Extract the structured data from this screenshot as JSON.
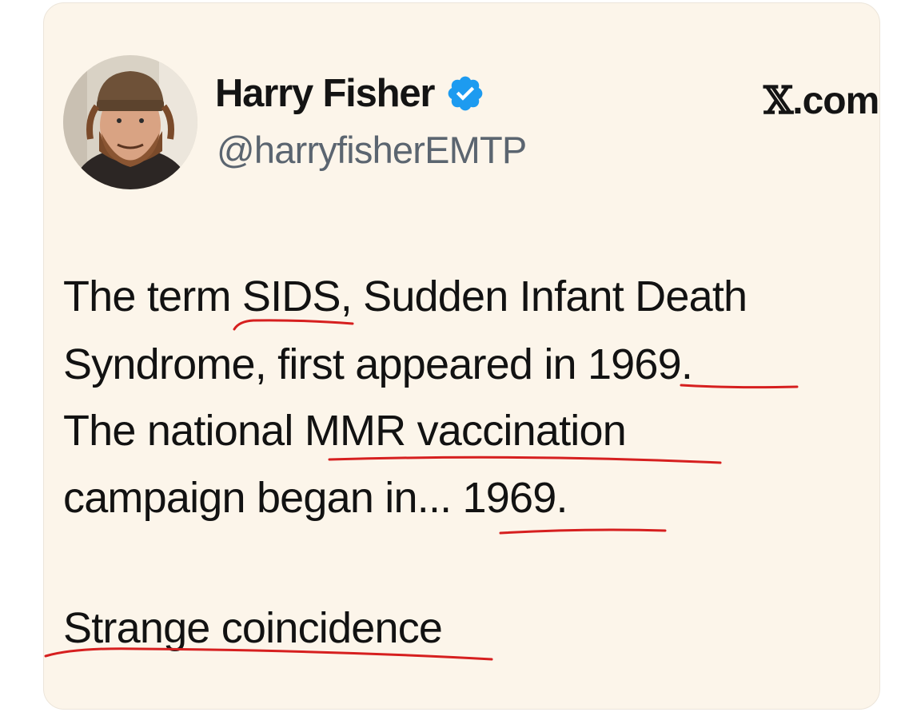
{
  "post": {
    "author_name": "Harry Fisher",
    "handle": "@harryfisherEMTP",
    "brand": "X.com",
    "brand_mark": "𝕏",
    "brand_suffix": ".com",
    "verified": true,
    "lines": [
      "The term SIDS, Sudden Infant Death",
      "Syndrome, first appeared in 1969.",
      "The national MMR vaccination",
      "campaign began in... 1969.",
      "Strange coincidence"
    ]
  },
  "icons": {
    "verified": "verified-badge-icon",
    "avatar": "profile-photo"
  },
  "annotation": {
    "color": "#d61f1f",
    "underlined_phrases": [
      "SIDS",
      "1969.",
      "MMR vaccination",
      "1969.",
      "Strange coincidence"
    ]
  },
  "colors": {
    "card_background": "#fcf5ea",
    "verified_blue": "#1d9bf0",
    "text": "#121212",
    "handle": "#5b6570"
  }
}
